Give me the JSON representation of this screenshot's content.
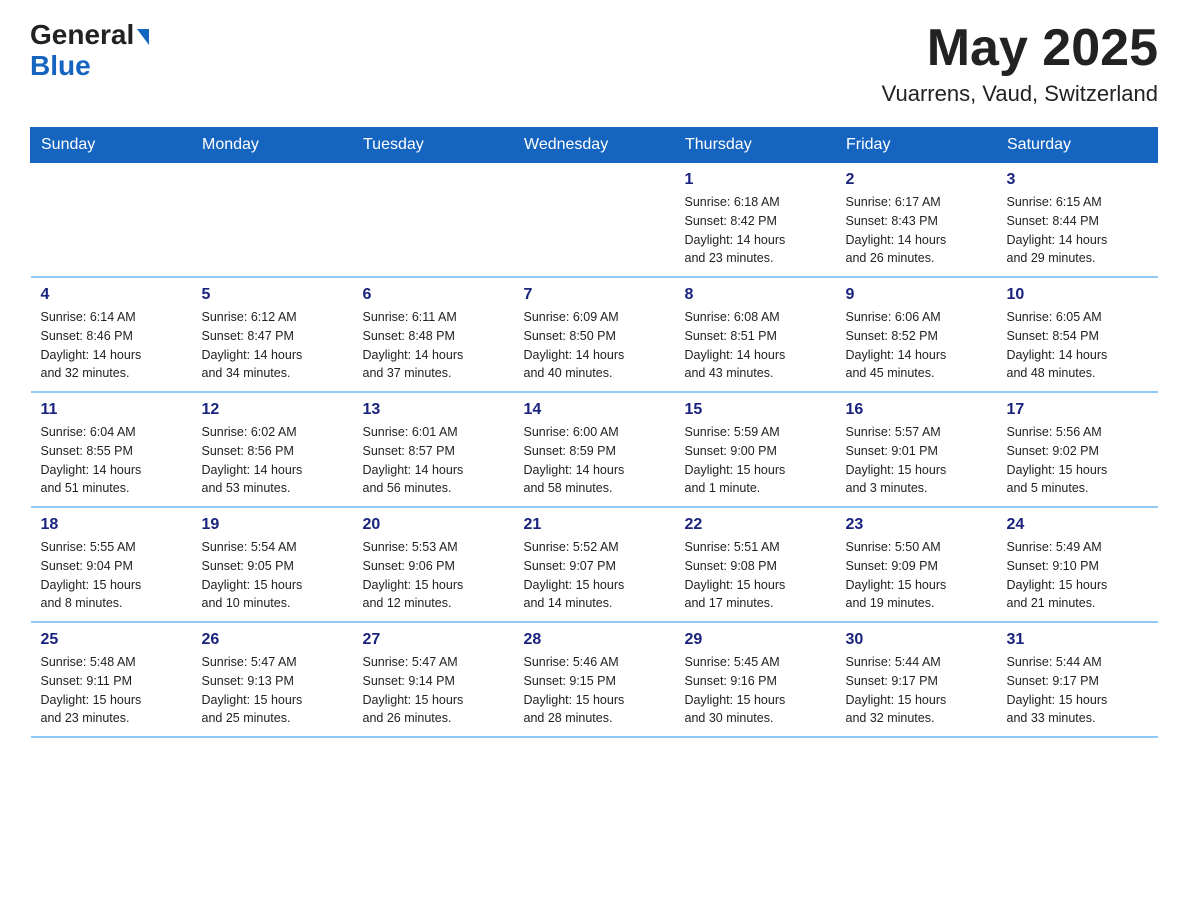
{
  "header": {
    "logo_general": "General",
    "logo_blue": "Blue",
    "month_title": "May 2025",
    "location": "Vuarrens, Vaud, Switzerland"
  },
  "weekdays": [
    "Sunday",
    "Monday",
    "Tuesday",
    "Wednesday",
    "Thursday",
    "Friday",
    "Saturday"
  ],
  "weeks": [
    [
      {
        "day": "",
        "info": ""
      },
      {
        "day": "",
        "info": ""
      },
      {
        "day": "",
        "info": ""
      },
      {
        "day": "",
        "info": ""
      },
      {
        "day": "1",
        "info": "Sunrise: 6:18 AM\nSunset: 8:42 PM\nDaylight: 14 hours\nand 23 minutes."
      },
      {
        "day": "2",
        "info": "Sunrise: 6:17 AM\nSunset: 8:43 PM\nDaylight: 14 hours\nand 26 minutes."
      },
      {
        "day": "3",
        "info": "Sunrise: 6:15 AM\nSunset: 8:44 PM\nDaylight: 14 hours\nand 29 minutes."
      }
    ],
    [
      {
        "day": "4",
        "info": "Sunrise: 6:14 AM\nSunset: 8:46 PM\nDaylight: 14 hours\nand 32 minutes."
      },
      {
        "day": "5",
        "info": "Sunrise: 6:12 AM\nSunset: 8:47 PM\nDaylight: 14 hours\nand 34 minutes."
      },
      {
        "day": "6",
        "info": "Sunrise: 6:11 AM\nSunset: 8:48 PM\nDaylight: 14 hours\nand 37 minutes."
      },
      {
        "day": "7",
        "info": "Sunrise: 6:09 AM\nSunset: 8:50 PM\nDaylight: 14 hours\nand 40 minutes."
      },
      {
        "day": "8",
        "info": "Sunrise: 6:08 AM\nSunset: 8:51 PM\nDaylight: 14 hours\nand 43 minutes."
      },
      {
        "day": "9",
        "info": "Sunrise: 6:06 AM\nSunset: 8:52 PM\nDaylight: 14 hours\nand 45 minutes."
      },
      {
        "day": "10",
        "info": "Sunrise: 6:05 AM\nSunset: 8:54 PM\nDaylight: 14 hours\nand 48 minutes."
      }
    ],
    [
      {
        "day": "11",
        "info": "Sunrise: 6:04 AM\nSunset: 8:55 PM\nDaylight: 14 hours\nand 51 minutes."
      },
      {
        "day": "12",
        "info": "Sunrise: 6:02 AM\nSunset: 8:56 PM\nDaylight: 14 hours\nand 53 minutes."
      },
      {
        "day": "13",
        "info": "Sunrise: 6:01 AM\nSunset: 8:57 PM\nDaylight: 14 hours\nand 56 minutes."
      },
      {
        "day": "14",
        "info": "Sunrise: 6:00 AM\nSunset: 8:59 PM\nDaylight: 14 hours\nand 58 minutes."
      },
      {
        "day": "15",
        "info": "Sunrise: 5:59 AM\nSunset: 9:00 PM\nDaylight: 15 hours\nand 1 minute."
      },
      {
        "day": "16",
        "info": "Sunrise: 5:57 AM\nSunset: 9:01 PM\nDaylight: 15 hours\nand 3 minutes."
      },
      {
        "day": "17",
        "info": "Sunrise: 5:56 AM\nSunset: 9:02 PM\nDaylight: 15 hours\nand 5 minutes."
      }
    ],
    [
      {
        "day": "18",
        "info": "Sunrise: 5:55 AM\nSunset: 9:04 PM\nDaylight: 15 hours\nand 8 minutes."
      },
      {
        "day": "19",
        "info": "Sunrise: 5:54 AM\nSunset: 9:05 PM\nDaylight: 15 hours\nand 10 minutes."
      },
      {
        "day": "20",
        "info": "Sunrise: 5:53 AM\nSunset: 9:06 PM\nDaylight: 15 hours\nand 12 minutes."
      },
      {
        "day": "21",
        "info": "Sunrise: 5:52 AM\nSunset: 9:07 PM\nDaylight: 15 hours\nand 14 minutes."
      },
      {
        "day": "22",
        "info": "Sunrise: 5:51 AM\nSunset: 9:08 PM\nDaylight: 15 hours\nand 17 minutes."
      },
      {
        "day": "23",
        "info": "Sunrise: 5:50 AM\nSunset: 9:09 PM\nDaylight: 15 hours\nand 19 minutes."
      },
      {
        "day": "24",
        "info": "Sunrise: 5:49 AM\nSunset: 9:10 PM\nDaylight: 15 hours\nand 21 minutes."
      }
    ],
    [
      {
        "day": "25",
        "info": "Sunrise: 5:48 AM\nSunset: 9:11 PM\nDaylight: 15 hours\nand 23 minutes."
      },
      {
        "day": "26",
        "info": "Sunrise: 5:47 AM\nSunset: 9:13 PM\nDaylight: 15 hours\nand 25 minutes."
      },
      {
        "day": "27",
        "info": "Sunrise: 5:47 AM\nSunset: 9:14 PM\nDaylight: 15 hours\nand 26 minutes."
      },
      {
        "day": "28",
        "info": "Sunrise: 5:46 AM\nSunset: 9:15 PM\nDaylight: 15 hours\nand 28 minutes."
      },
      {
        "day": "29",
        "info": "Sunrise: 5:45 AM\nSunset: 9:16 PM\nDaylight: 15 hours\nand 30 minutes."
      },
      {
        "day": "30",
        "info": "Sunrise: 5:44 AM\nSunset: 9:17 PM\nDaylight: 15 hours\nand 32 minutes."
      },
      {
        "day": "31",
        "info": "Sunrise: 5:44 AM\nSunset: 9:17 PM\nDaylight: 15 hours\nand 33 minutes."
      }
    ]
  ]
}
